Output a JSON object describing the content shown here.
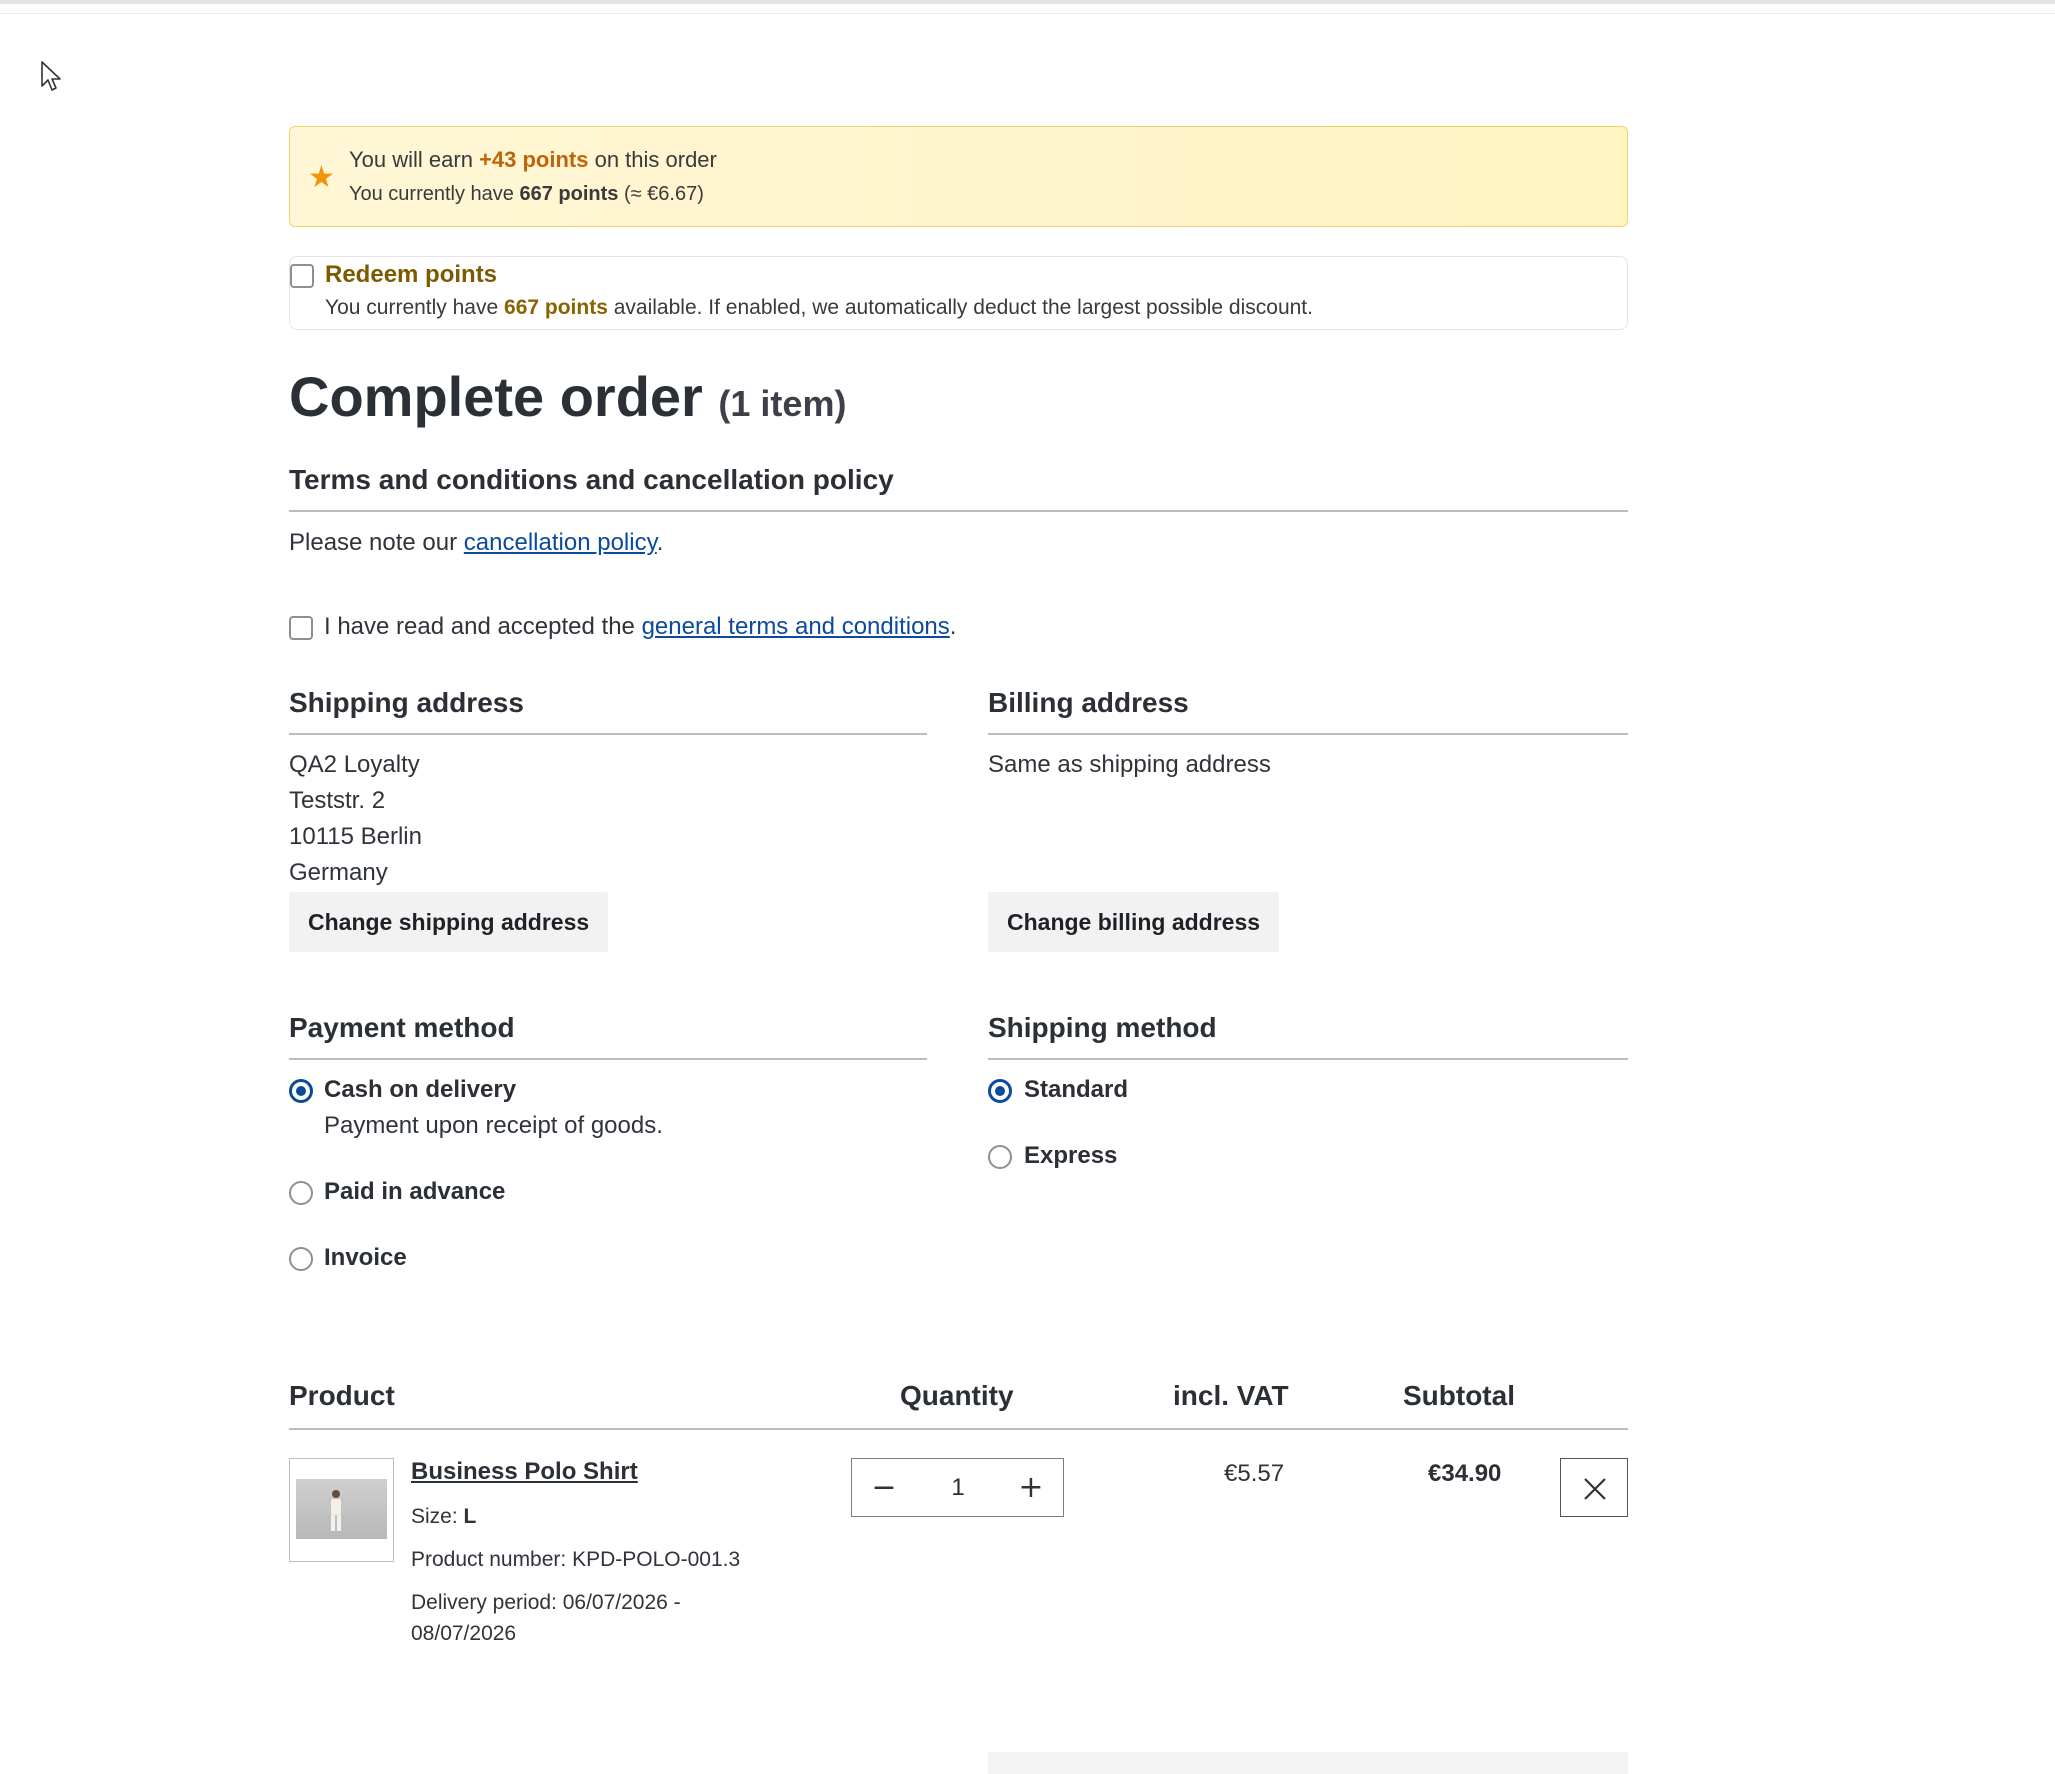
{
  "points_banner": {
    "earn_prefix": "You will earn ",
    "earn_points": "+43 points",
    "earn_suffix": " on this order",
    "have_prefix": "You currently have ",
    "have_points": "667 points",
    "have_suffix": " (≈ €6.67)"
  },
  "redeem": {
    "title": "Redeem points",
    "desc_prefix": "You currently have ",
    "desc_points": "667 points",
    "desc_suffix": " available. If enabled, we automatically deduct the largest possible discount.",
    "checked": false
  },
  "page": {
    "title": "Complete order",
    "item_count": "(1 item)"
  },
  "terms": {
    "heading": "Terms and conditions and cancellation policy",
    "note_prefix": "Please note our ",
    "note_link": "cancellation policy",
    "note_suffix": ".",
    "accept_prefix": "I have read and accepted the ",
    "accept_link": "general terms and conditions",
    "accept_suffix": "."
  },
  "shipping_address": {
    "heading": "Shipping address",
    "lines": [
      "QA2 Loyalty",
      "Teststr. 2",
      "10115 Berlin",
      "Germany"
    ],
    "button": "Change shipping address"
  },
  "billing_address": {
    "heading": "Billing address",
    "text": "Same as shipping address",
    "button": "Change billing address"
  },
  "payment": {
    "heading": "Payment method",
    "options": [
      {
        "label": "Cash on delivery",
        "desc": "Payment upon receipt of goods.",
        "selected": true
      },
      {
        "label": "Paid in advance",
        "selected": false
      },
      {
        "label": "Invoice",
        "selected": false
      }
    ]
  },
  "shipping_method": {
    "heading": "Shipping method",
    "options": [
      {
        "label": "Standard",
        "selected": true
      },
      {
        "label": "Express",
        "selected": false
      }
    ]
  },
  "table": {
    "headers": {
      "product": "Product",
      "quantity": "Quantity",
      "vat": "incl. VAT",
      "subtotal": "Subtotal"
    },
    "rows": [
      {
        "name": "Business Polo Shirt",
        "size_label": "Size: ",
        "size_value": "L",
        "product_number": "Product number: KPD-POLO-001.3",
        "delivery_line1": "Delivery period: 06/07/2026 -",
        "delivery_line2": "08/07/2026",
        "quantity": "1",
        "vat": "€5.57",
        "subtotal": "€34.90"
      }
    ]
  },
  "icons": {
    "star": "star-icon",
    "minus": "minus-icon",
    "plus": "plus-icon",
    "remove": "close-icon",
    "cursor": "mouse-cursor-icon"
  },
  "colors": {
    "accent": "#0b4a9c",
    "points_orange": "#c0640a",
    "banner_bg": "#fff6d6",
    "banner_border": "#f1d36d"
  }
}
